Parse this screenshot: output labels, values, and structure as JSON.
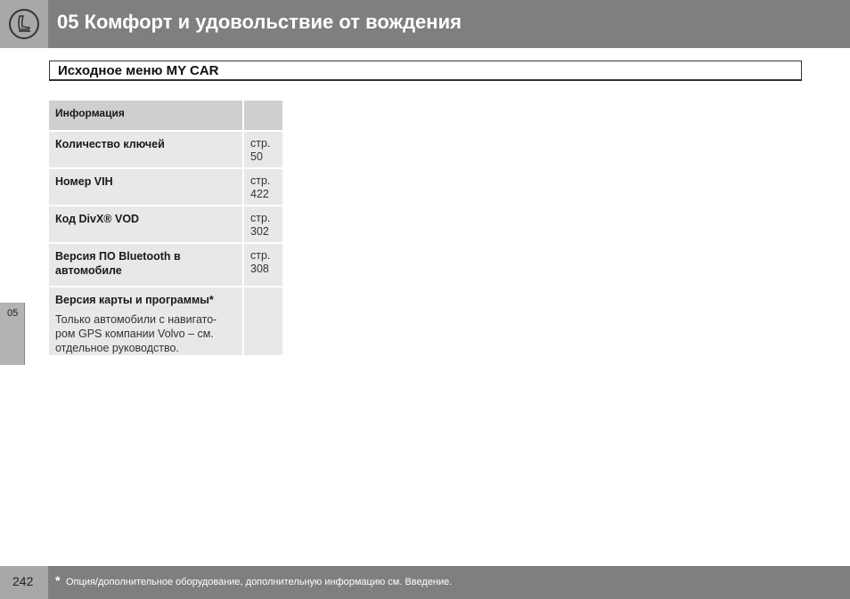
{
  "header": {
    "title": "05 Комфорт и удовольствие от вождения",
    "icon": "seat-icon"
  },
  "section": {
    "title": "Исходное меню MY CAR"
  },
  "table": {
    "heading": "Информация",
    "rows": [
      {
        "label": "Количество ключей",
        "page_prefix": "стр.",
        "page": "50"
      },
      {
        "label": "Номер VIH",
        "page_prefix": "стр.",
        "page": "422"
      },
      {
        "label": "Код DivX® VOD",
        "page_prefix": "стр.",
        "page": "302"
      },
      {
        "label": "Версия ПО Bluetooth в автомобиле",
        "page_prefix": "стр.",
        "page": "308"
      },
      {
        "label": "Версия карты и программы*",
        "note": "Только автомобили с навигато-ром GPS компании Volvo – см. отдельное руководство."
      }
    ]
  },
  "side_tab": {
    "label": "05"
  },
  "footer": {
    "page_number": "242",
    "star": "*",
    "note": "Опция/дополнительное оборудование, дополнительную информацию см. Введение."
  }
}
